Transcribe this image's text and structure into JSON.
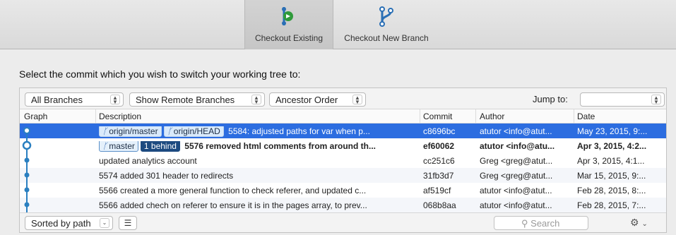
{
  "toolbar": {
    "checkout_existing": "Checkout Existing",
    "checkout_new_branch": "Checkout New Branch"
  },
  "prompt": "Select the commit which you wish to switch your working tree to:",
  "filters": {
    "branches": "All Branches",
    "remote": "Show Remote Branches",
    "order": "Ancestor Order",
    "jump_label": "Jump to:",
    "jump_value": ""
  },
  "columns": {
    "graph": "Graph",
    "description": "Description",
    "commit": "Commit",
    "author": "Author",
    "date": "Date"
  },
  "rows": [
    {
      "badges": [
        "origin/master",
        "origin/HEAD"
      ],
      "description": "5584: adjusted paths for  var when p...",
      "commit": "c8696bc",
      "author": "atutor <info@atut...",
      "date": "May 23, 2015, 9:..."
    },
    {
      "badges": [
        "master"
      ],
      "behind": "1 behind",
      "description": "5576 removed html comments from around th...",
      "commit": "ef60062",
      "author": "atutor <info@atu...",
      "date": "Apr 3, 2015, 4:2..."
    },
    {
      "description": "updated analytics account",
      "commit": "cc251c6",
      "author": "Greg <greg@atut...",
      "date": "Apr 3, 2015, 4:1..."
    },
    {
      "description": "5574 added 301 header to redirects",
      "commit": "31fb3d7",
      "author": "Greg <greg@atut...",
      "date": "Mar 15, 2015, 9:..."
    },
    {
      "description": "5566 created a more general function to check referer, and updated c...",
      "commit": "af519cf",
      "author": "atutor <info@atut...",
      "date": "Feb 28, 2015, 8:..."
    },
    {
      "description": "5566 added chech on referer to ensure it is in the pages array, to prev...",
      "commit": "068b8aa",
      "author": "atutor <info@atut...",
      "date": "Feb 28, 2015, 7:..."
    }
  ],
  "bottom": {
    "sort": "Sorted by path",
    "search_placeholder": "Search"
  },
  "colors": {
    "selection": "#2c6de0",
    "graph_line": "#2a7fc0",
    "checkout_icon": "#2f9a3a"
  },
  "icons": {
    "checkout_existing": "checkout-arrow-icon",
    "checkout_new": "branch-icon",
    "branch_badge": "branch-icon",
    "search": "search-icon",
    "gear": "gear-icon",
    "list": "list-icon"
  }
}
